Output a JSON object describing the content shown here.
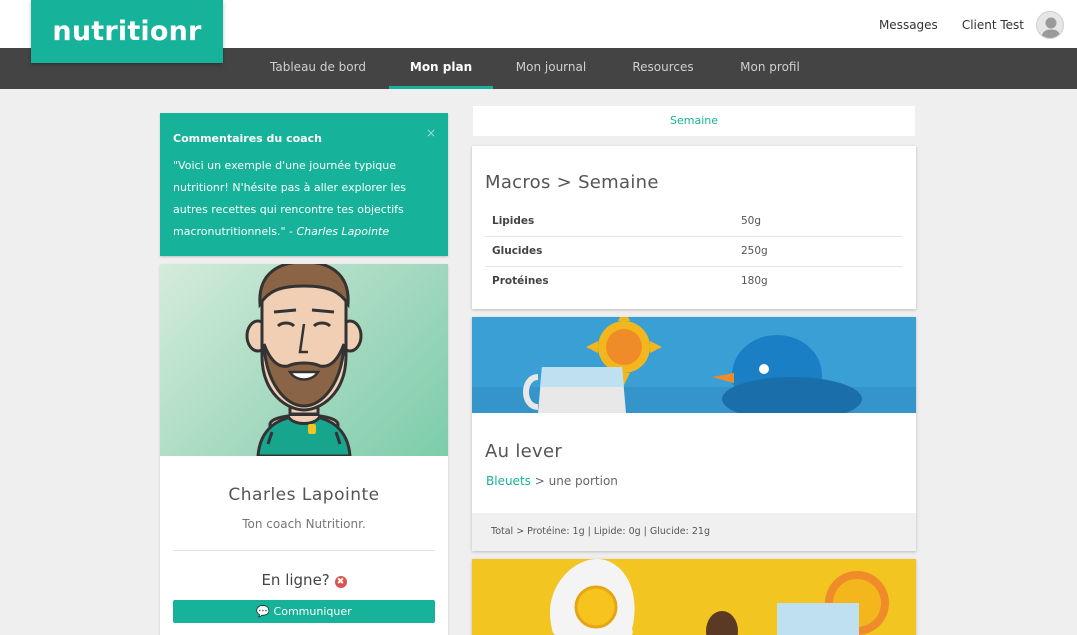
{
  "brand": {
    "logo_text": "nutritionr",
    "accent": "#17b29a"
  },
  "header": {
    "messages_label": "Messages",
    "user_name": "Client Test"
  },
  "nav": {
    "items": [
      {
        "label": "Tableau de bord"
      },
      {
        "label": "Mon plan",
        "active": true
      },
      {
        "label": "Mon journal"
      },
      {
        "label": "Resources"
      },
      {
        "label": "Mon profil"
      }
    ]
  },
  "coach_comment": {
    "title": "Commentaires du coach",
    "close": "×",
    "quote": "\"Voici un exemple d'une journée typique nutritionr! N'hésite pas à aller explorer les autres recettes qui rencontre tes objectifs macronutritionnels.\" - ",
    "signature": "Charles Lapointe"
  },
  "coach": {
    "name": "Charles Lapointe",
    "subtitle": "Ton coach Nutritionr.",
    "status_label": "En ligne?",
    "status_icon": "✖",
    "contact_icon": "💬",
    "contact_label": "Communiquer"
  },
  "plan": {
    "period_tab": "Semaine",
    "macros": {
      "title": "Macros > Semaine",
      "rows": [
        {
          "name": "Lipides",
          "value": "50g"
        },
        {
          "name": "Glucides",
          "value": "250g"
        },
        {
          "name": "Protéines",
          "value": "180g"
        }
      ]
    },
    "meal": {
      "title": "Au lever",
      "food": "Bleuets",
      "separator": ">",
      "portion": "une portion",
      "total": "Total > Protéine: 1g | Lipide: 0g | Glucide: 21g"
    }
  }
}
